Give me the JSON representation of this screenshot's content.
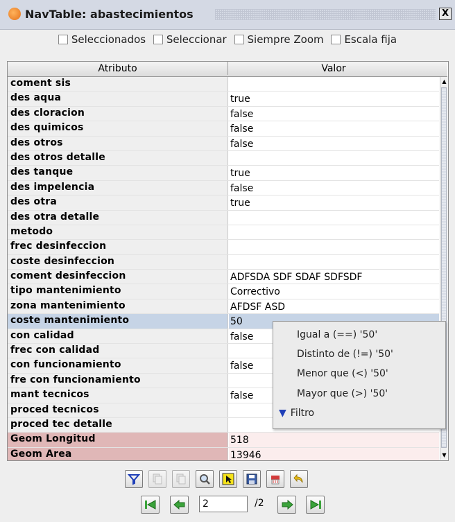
{
  "window": {
    "title": "NavTable: abastecimientos",
    "close_label": "X"
  },
  "options": [
    {
      "label": "Seleccionados",
      "checked": false
    },
    {
      "label": "Seleccionar",
      "checked": false
    },
    {
      "label": "Siempre Zoom",
      "checked": false
    },
    {
      "label": "Escala fija",
      "checked": false
    }
  ],
  "table": {
    "headers": {
      "attribute": "Atributo",
      "value": "Valor"
    },
    "rows": [
      {
        "attr": "coment sis",
        "val": ""
      },
      {
        "attr": "des aqua",
        "val": "true"
      },
      {
        "attr": "des cloracion",
        "val": "false"
      },
      {
        "attr": "des quimicos",
        "val": "false"
      },
      {
        "attr": "des otros",
        "val": "false"
      },
      {
        "attr": "des otros detalle",
        "val": ""
      },
      {
        "attr": "des tanque",
        "val": "true"
      },
      {
        "attr": "des impelencia",
        "val": "false"
      },
      {
        "attr": "des otra",
        "val": "true"
      },
      {
        "attr": "des otra detalle",
        "val": ""
      },
      {
        "attr": "metodo",
        "val": ""
      },
      {
        "attr": "frec desinfeccion",
        "val": ""
      },
      {
        "attr": "coste desinfeccion",
        "val": ""
      },
      {
        "attr": "coment desinfeccion",
        "val": "ADFSDA SDF SDAF SDFSDF"
      },
      {
        "attr": "tipo mantenimiento",
        "val": "Correctivo"
      },
      {
        "attr": "zona mantenimiento",
        "val": "AFDSF ASD"
      },
      {
        "attr": "coste mantenimiento",
        "val": "50",
        "selected": true
      },
      {
        "attr": "con calidad",
        "val": "false"
      },
      {
        "attr": "frec con calidad",
        "val": ""
      },
      {
        "attr": "con funcionamiento",
        "val": "false"
      },
      {
        "attr": "fre con funcionamiento",
        "val": ""
      },
      {
        "attr": "mant tecnicos",
        "val": "false"
      },
      {
        "attr": "proced tecnicos",
        "val": ""
      },
      {
        "attr": "proced tec detalle",
        "val": ""
      },
      {
        "attr": "Geom Longitud",
        "val": "518",
        "geom": true
      },
      {
        "attr": "Geom Area",
        "val": "13946",
        "geom": true
      }
    ]
  },
  "context_menu": {
    "items": [
      "Igual a (==) '50'",
      "Distinto de (!=) '50'",
      "Menor que (<) '50'",
      "Mayor que (>) '50'"
    ],
    "filter_label": "Filtro"
  },
  "toolbar": {
    "icons": [
      "filter-icon",
      "copy-selected-icon",
      "copy-previous-icon",
      "zoom-icon",
      "select-icon",
      "save-icon",
      "delete-icon",
      "undo-icon"
    ]
  },
  "navigation": {
    "current_page": "2",
    "total_label": "/2"
  },
  "colors": {
    "selected_row": "#c6d4e6",
    "geom_attr_bg": "#e0b7b7",
    "geom_val_bg": "#fbeded",
    "toolbar_accent_yellow": "#f5e21a",
    "nav_green": "#3aa33a"
  }
}
